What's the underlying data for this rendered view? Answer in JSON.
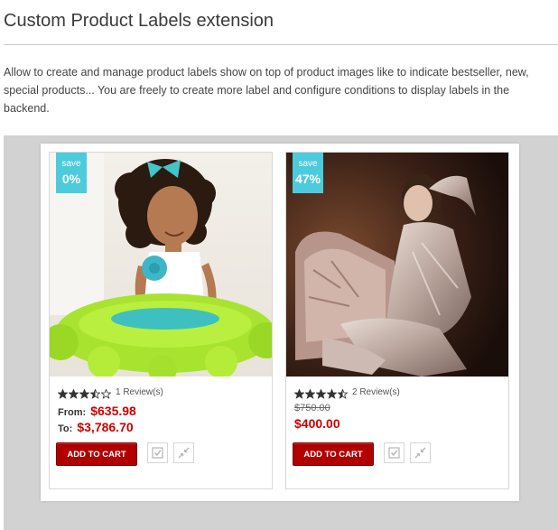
{
  "header": {
    "title": "Custom Product Labels extension"
  },
  "description": "Allow to create and manage product labels show on top of product images like to indicate bestseller, new, special products... You are freely to create more label and configure conditions to display labels in the backend.",
  "colors": {
    "badge": "#4ccbdd",
    "price": "#cc0000",
    "button": "#b00000"
  },
  "products": [
    {
      "badge_top": "save",
      "badge_value": "0%",
      "rating": 3.5,
      "reviews": "1 Review(s)",
      "from_label": "From:",
      "from_price": "$635.98",
      "to_label": "To:",
      "to_price": "$3,786.70",
      "button": "ADD TO CART",
      "wishlist_icon": "wishlist-icon",
      "compare_icon": "compare-icon"
    },
    {
      "badge_top": "save",
      "badge_value": "47%",
      "rating": 4.5,
      "reviews": "2 Review(s)",
      "old_price": "$750.00",
      "special_price": "$400.00",
      "button": "ADD TO CART",
      "wishlist_icon": "wishlist-icon",
      "compare_icon": "compare-icon"
    }
  ]
}
